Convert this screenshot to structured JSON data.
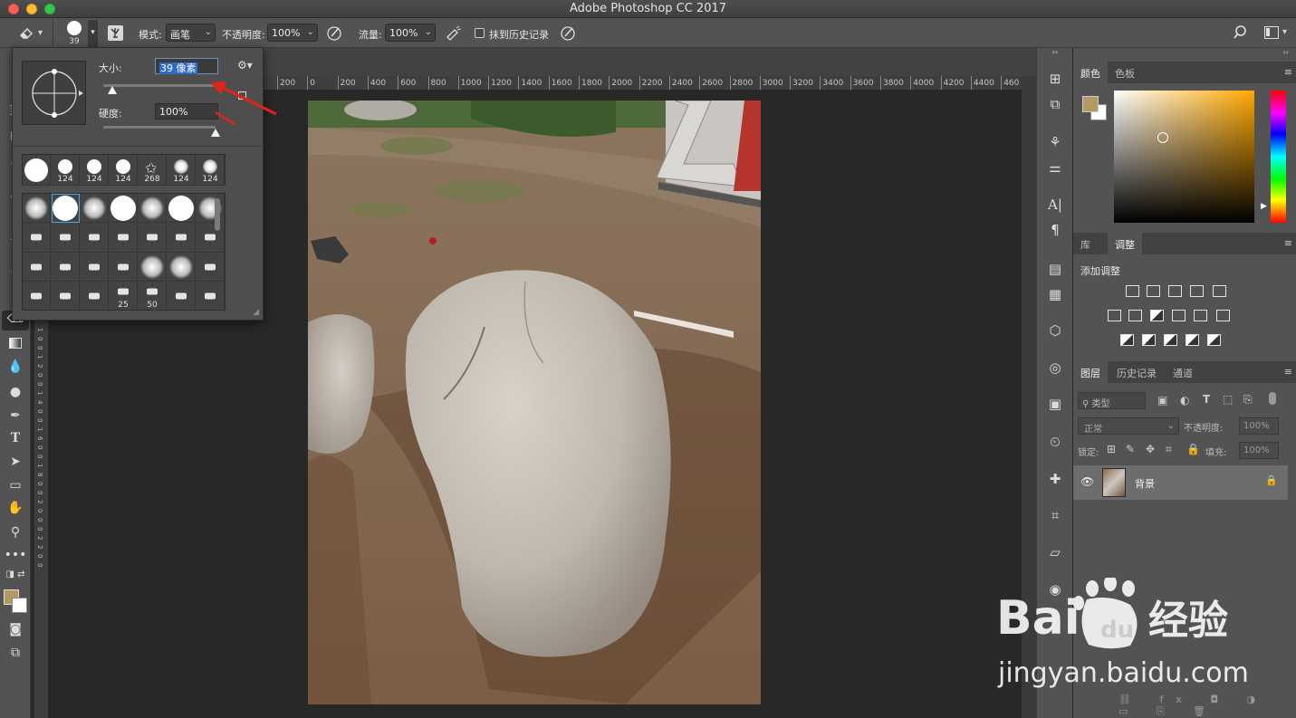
{
  "window": {
    "title": "Adobe Photoshop CC 2017"
  },
  "options_bar": {
    "brush_size_label": "39",
    "mode_label": "模式:",
    "mode_value": "画笔",
    "opacity_label": "不透明度:",
    "opacity_value": "100%",
    "flow_label": "流量:",
    "flow_value": "100%",
    "erase_history_label": "抹到历史记录"
  },
  "brush_picker": {
    "size_label": "大小:",
    "size_value": "39 像素",
    "size_fraction": 0.08,
    "hardness_label": "硬度:",
    "hardness_value": "100%",
    "hardness_fraction": 1.0,
    "preset_row1": [
      {
        "label": ""
      },
      {
        "label": "124"
      },
      {
        "label": "124"
      },
      {
        "label": "124"
      },
      {
        "label": "268"
      },
      {
        "label": "124"
      },
      {
        "label": "124"
      }
    ],
    "preset_rows": [
      [
        "",
        "",
        "",
        "",
        "",
        "",
        ""
      ],
      [
        "",
        "",
        "",
        "",
        "",
        "",
        ""
      ],
      [
        "",
        "",
        "",
        "",
        "",
        "",
        ""
      ],
      [
        "",
        "",
        "",
        "25",
        "50",
        "",
        ""
      ]
    ]
  },
  "ruler": {
    "h_ticks": [
      "200",
      "0",
      "200",
      "400",
      "600",
      "800",
      "1000",
      "1200",
      "1400",
      "1600",
      "1800",
      "2000",
      "2200",
      "2400",
      "2600",
      "2800",
      "3000",
      "3200",
      "3400",
      "3600",
      "3800",
      "4000",
      "4200",
      "4400",
      "460"
    ],
    "v_ticks": [
      "1",
      "0",
      "0",
      "1",
      "2",
      "0",
      "0",
      "1",
      "4",
      "0",
      "0",
      "1",
      "6",
      "0",
      "0",
      "1",
      "8",
      "0",
      "0",
      "2",
      "0",
      "0",
      "0",
      "2",
      "2",
      "0",
      "0"
    ]
  },
  "color_panel": {
    "tabs": [
      "颜色",
      "色板"
    ],
    "foreground": "#b39a63",
    "background": "#ffffff",
    "hue": "#ffa800"
  },
  "adjust_panel": {
    "tabs": [
      "库",
      "调整"
    ],
    "title": "添加调整"
  },
  "layers_panel": {
    "tabs": [
      "图层",
      "历史记录",
      "通道"
    ],
    "filter_label": "类型",
    "blend_mode": "正常",
    "opacity_label": "不透明度:",
    "opacity_value": "100%",
    "lock_label": "锁定:",
    "fill_label": "填充:",
    "fill_value": "100%",
    "layers": [
      {
        "name": "背景",
        "locked": true,
        "visible": true
      }
    ]
  },
  "watermark": {
    "brand": "Bai",
    "brand2": "经验",
    "url": "jingyan.baidu.com"
  }
}
